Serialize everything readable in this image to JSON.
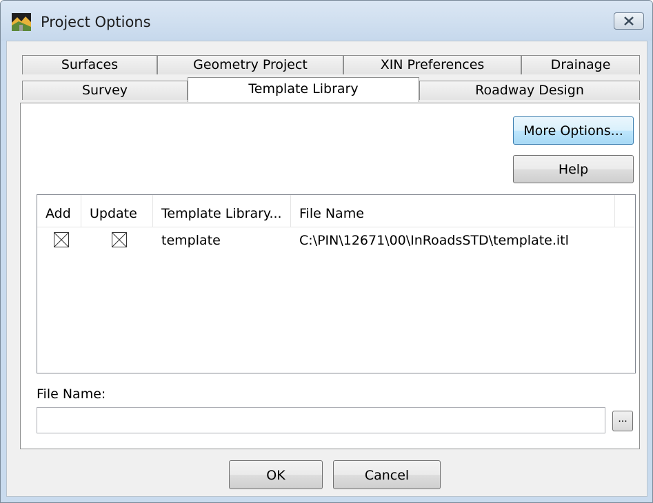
{
  "window": {
    "title": "Project Options",
    "icon": "app-icon",
    "close_icon": "close-icon"
  },
  "tabs": {
    "row1": [
      {
        "label": "Surfaces"
      },
      {
        "label": "Geometry Project"
      },
      {
        "label": "XIN Preferences"
      },
      {
        "label": "Drainage"
      }
    ],
    "row2": [
      {
        "label": "Survey"
      },
      {
        "label": "Template Library",
        "selected": true
      },
      {
        "label": "Roadway Design"
      }
    ]
  },
  "buttons": {
    "more_options": "More Options...",
    "help": "Help",
    "ok": "OK",
    "cancel": "Cancel",
    "browse": "..."
  },
  "list": {
    "columns": [
      "Add",
      "Update",
      "Template Library...",
      "File Name"
    ],
    "rows": [
      {
        "add": true,
        "update": true,
        "template_library": "template",
        "file_name": "C:\\PIN\\12671\\00\\InRoadsSTD\\template.itl"
      }
    ]
  },
  "file_name_field": {
    "label": "File Name:",
    "value": ""
  },
  "colors": {
    "title_bar": "#c9dbee",
    "focused_button": "#bee6fd"
  }
}
